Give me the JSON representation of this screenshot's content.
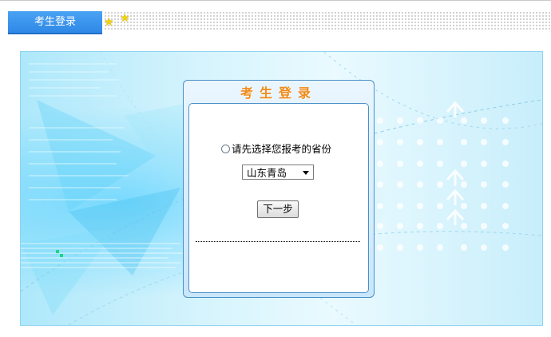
{
  "header": {
    "tab_label": "考生登录"
  },
  "login_box": {
    "title": "考生登录",
    "prompt": "请先选择您报考的省份",
    "province_selected": "山东青岛",
    "next_label": "下一步"
  },
  "colors": {
    "tab": "#2f88e6",
    "title": "#f08a1a",
    "panel_border": "#8fd3ef",
    "box_border": "#4a90c8"
  },
  "icons": [
    "star-icon",
    "star-icon",
    "radio-icon",
    "chevron-down-icon",
    "arrow-up-icon"
  ]
}
